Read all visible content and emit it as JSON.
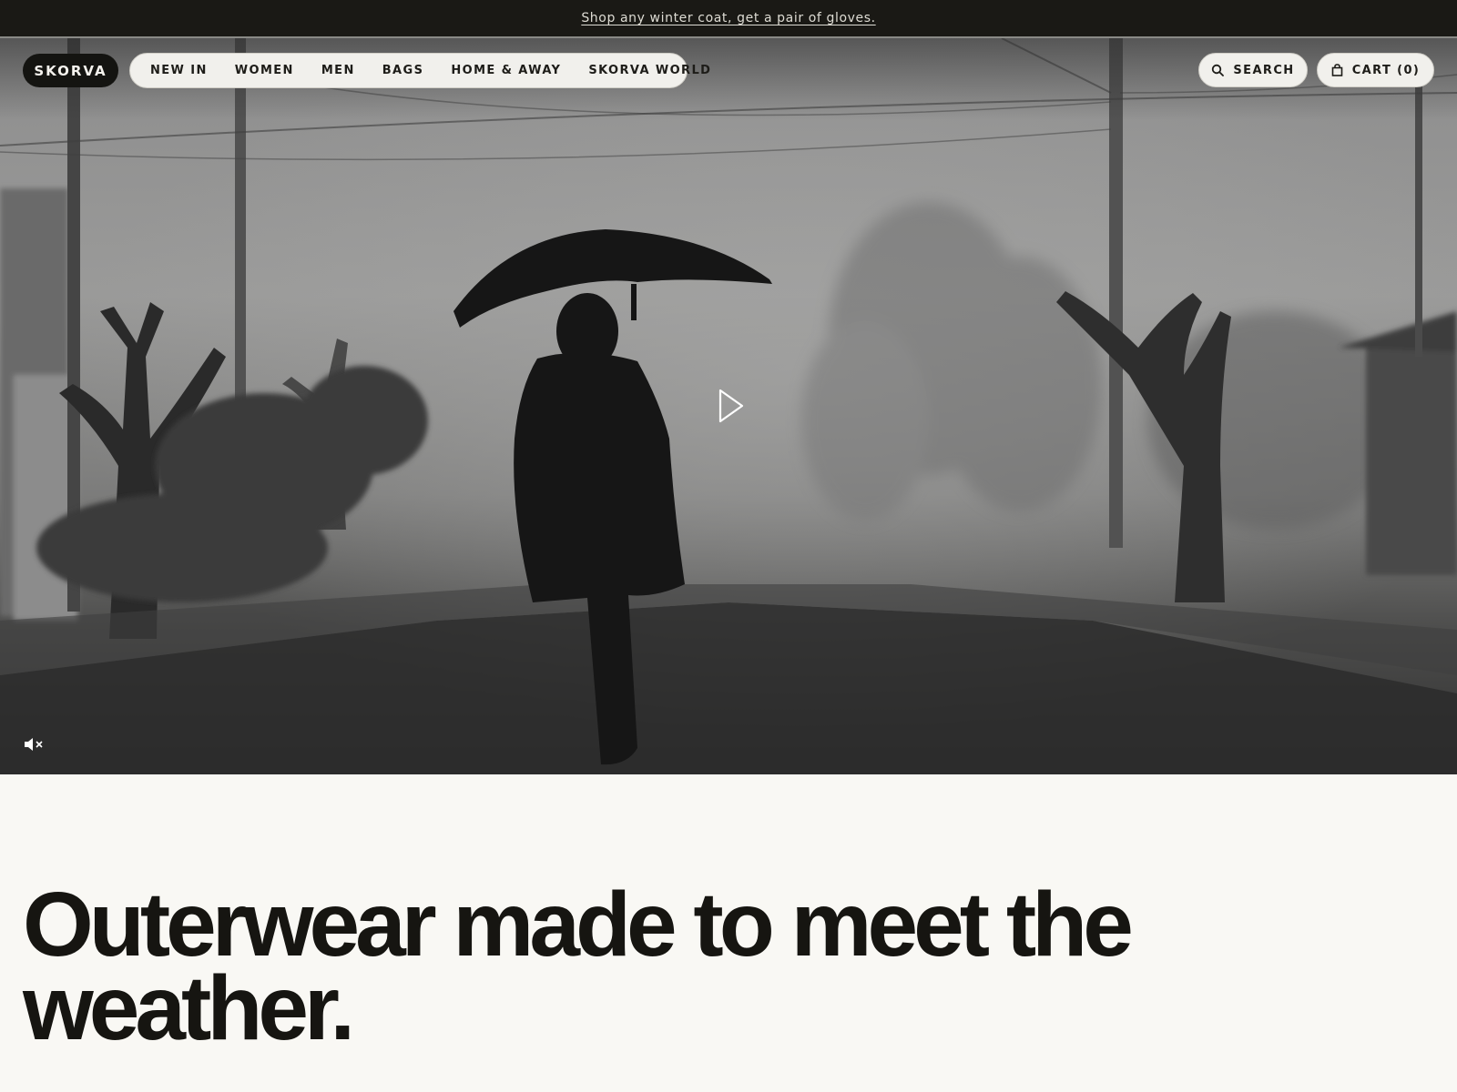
{
  "announcement": {
    "text": "Shop any winter coat, get a pair of gloves."
  },
  "header": {
    "logo": "SKORVA",
    "nav": [
      {
        "label": "NEW IN"
      },
      {
        "label": "WOMEN"
      },
      {
        "label": "MEN"
      },
      {
        "label": "BAGS"
      },
      {
        "label": "HOME & AWAY"
      },
      {
        "label": "SKORVA WORLD"
      }
    ],
    "search_label": "SEARCH",
    "search_icon": "search-icon",
    "cart_label": "CART (0)",
    "cart_icon": "bag-icon"
  },
  "hero": {
    "media": "video",
    "play_icon": "play-icon",
    "mute_icon": "muted-speaker-icon"
  },
  "main": {
    "headline": "Outerwear made to meet the weather."
  },
  "colors": {
    "page_background": "#f9f8f4",
    "announcement_bar": "#1a1915",
    "text": "#161511",
    "pill_background": "#f1f0ec"
  }
}
